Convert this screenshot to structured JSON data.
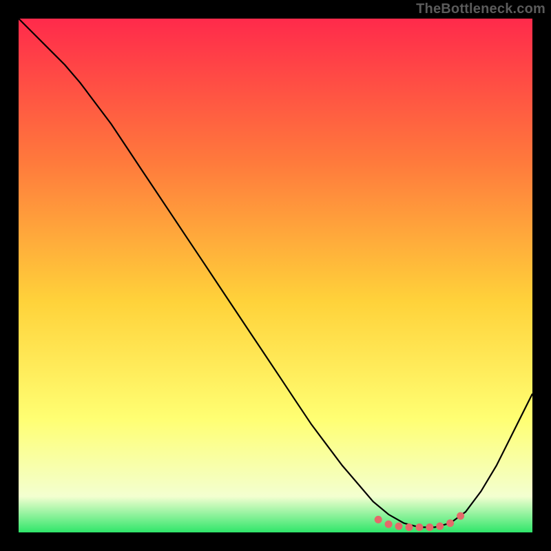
{
  "watermark": "TheBottleneck.com",
  "colors": {
    "bg": "#000000",
    "grad_top": "#ff2a4b",
    "grad_mid1": "#ff7a3c",
    "grad_mid2": "#ffd23a",
    "grad_mid3": "#ffff73",
    "grad_bot1": "#f3ffd0",
    "grad_bot2": "#2fe66a",
    "curve": "#000000",
    "dots": "#e46a6a"
  },
  "chart_data": {
    "type": "line",
    "title": "",
    "xlabel": "",
    "ylabel": "",
    "xlim": [
      0,
      100
    ],
    "ylim": [
      0,
      100
    ],
    "series": [
      {
        "name": "bottleneck-curve",
        "x": [
          0,
          3,
          6,
          9,
          12,
          15,
          18,
          21,
          24,
          27,
          30,
          33,
          36,
          39,
          42,
          45,
          48,
          51,
          54,
          57,
          60,
          63,
          66,
          69,
          72,
          75,
          78,
          81,
          84,
          87,
          90,
          93,
          96,
          100
        ],
        "y": [
          100,
          97,
          94,
          91,
          87.5,
          83.5,
          79.5,
          75,
          70.5,
          66,
          61.5,
          57,
          52.5,
          48,
          43.5,
          39,
          34.5,
          30,
          25.5,
          21,
          17,
          13,
          9.5,
          6,
          3.5,
          1.8,
          1,
          1,
          1.8,
          4,
          8,
          13,
          19,
          27
        ]
      },
      {
        "name": "optimal-range-markers",
        "x": [
          70,
          72,
          74,
          76,
          78,
          80,
          82,
          84,
          86
        ],
        "y": [
          2.5,
          1.6,
          1.2,
          1.0,
          1.0,
          1.0,
          1.2,
          1.8,
          3.2
        ]
      }
    ]
  }
}
